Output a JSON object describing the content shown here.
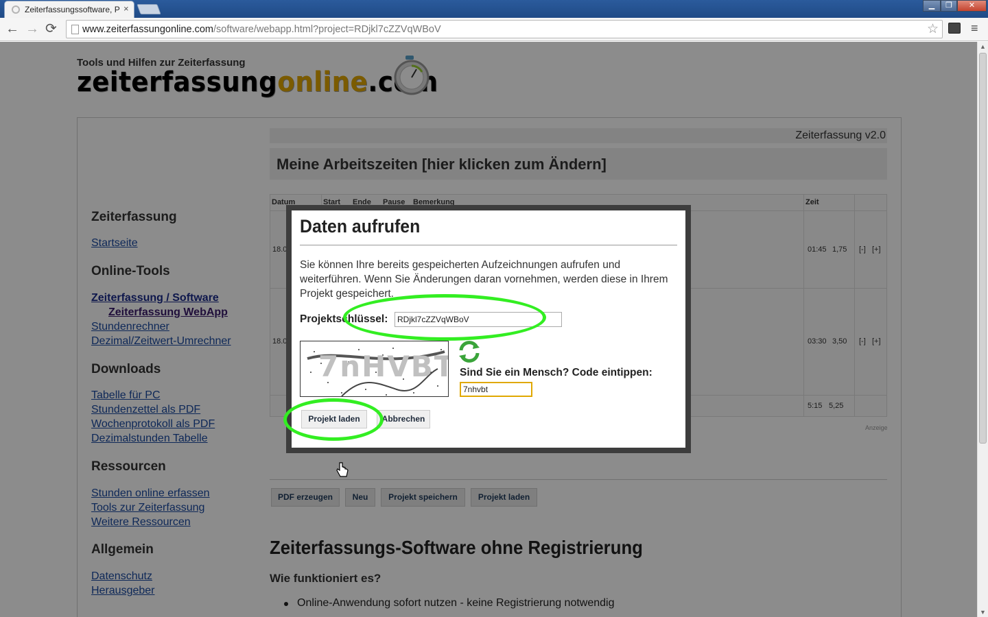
{
  "browser": {
    "tab_title": "Zeiterfassungssoftware, P",
    "tab_close": "×",
    "url_host": "www.zeiterfassungonline.com",
    "url_rest": "/software/webapp.html?project=RDjkl7cZZVqWBoV",
    "back": "←",
    "forward": "→",
    "reload": "⟳",
    "star": "☆",
    "menu": "≡",
    "win_min": "▁",
    "win_max": "❐",
    "win_close": "✕"
  },
  "site": {
    "tagline": "Tools und Hilfen zur Zeiterfassung",
    "logo_part1": "zeiterfassung",
    "logo_part2": "online",
    "logo_part3": ".com"
  },
  "app": {
    "version": "Zeiterfassung v2.0",
    "header": "Meine Arbeitszeiten [hier klicken zum Ändern]",
    "columns": [
      "Datum",
      "Start",
      "Ende",
      "Pause",
      "Bemerkung",
      "Zeit"
    ],
    "rows": [
      {
        "date": "18.0",
        "zeit": "01:45",
        "dezimal": "1,75",
        "minus": "[-]",
        "plus": "[+]"
      },
      {
        "date": "18.0",
        "zeit": "03:30",
        "dezimal": "3,50",
        "minus": "[-]",
        "plus": "[+]"
      }
    ],
    "total": {
      "zeit": "5:15",
      "dezimal": "5,25"
    },
    "ad_label": "Anzeige",
    "buttons": {
      "pdf": "PDF erzeugen",
      "new": "Neu",
      "save": "Projekt speichern",
      "load": "Projekt laden"
    }
  },
  "sidebar": {
    "section_zeiterfassung": "Zeiterfassung",
    "startseite": "Startseite",
    "section_tools": "Online-Tools",
    "tool_software": "Zeiterfassung / Software",
    "tool_webapp": "Zeiterfassung WebApp",
    "tool_stunden": "Stundenrechner",
    "tool_dezimal": "Dezimal/Zeitwert-Umrechner",
    "section_downloads": "Downloads",
    "dl_tabelle": "Tabelle für PC",
    "dl_stundenzettel": "Stundenzettel als PDF",
    "dl_wochen": "Wochenprotokoll als PDF",
    "dl_dezimal": "Dezimalstunden Tabelle",
    "section_ressourcen": "Ressourcen",
    "res_online": "Stunden online erfassen",
    "res_tools": "Tools zur Zeiterfassung",
    "res_weitere": "Weitere Ressourcen",
    "section_allgemein": "Allgemein",
    "datenschutz": "Datenschutz",
    "herausgeber": "Herausgeber"
  },
  "article": {
    "title": "Zeiterfassungs-Software ohne Registrierung",
    "subtitle": "Wie funktioniert es?",
    "bullet1": "Online-Anwendung sofort nutzen - keine Registrierung notwendig"
  },
  "modal": {
    "title": "Daten aufrufen",
    "description": "Sie können Ihre bereits gespeicherten Aufzeichnungen aufrufen und weiterführen. Wenn Sie Änderungen daran vornehmen, werden diese in Ihrem Projekt gespeichert.",
    "key_label": "Projektschlüssel:",
    "key_value": "RDjkl7cZZVqWBoV",
    "captcha_image_text": "7nHVBT",
    "captcha_label": "Sind Sie ein Mensch? Code eintippen:",
    "captcha_value": "7nhvbt",
    "load_button": "Projekt laden",
    "cancel_button": "Abbrechen"
  },
  "colors": {
    "highlight": "#33ee22",
    "logo_accent": "#e0a700",
    "link": "#1a4aa0",
    "modal_border": "#3d3d3d"
  }
}
